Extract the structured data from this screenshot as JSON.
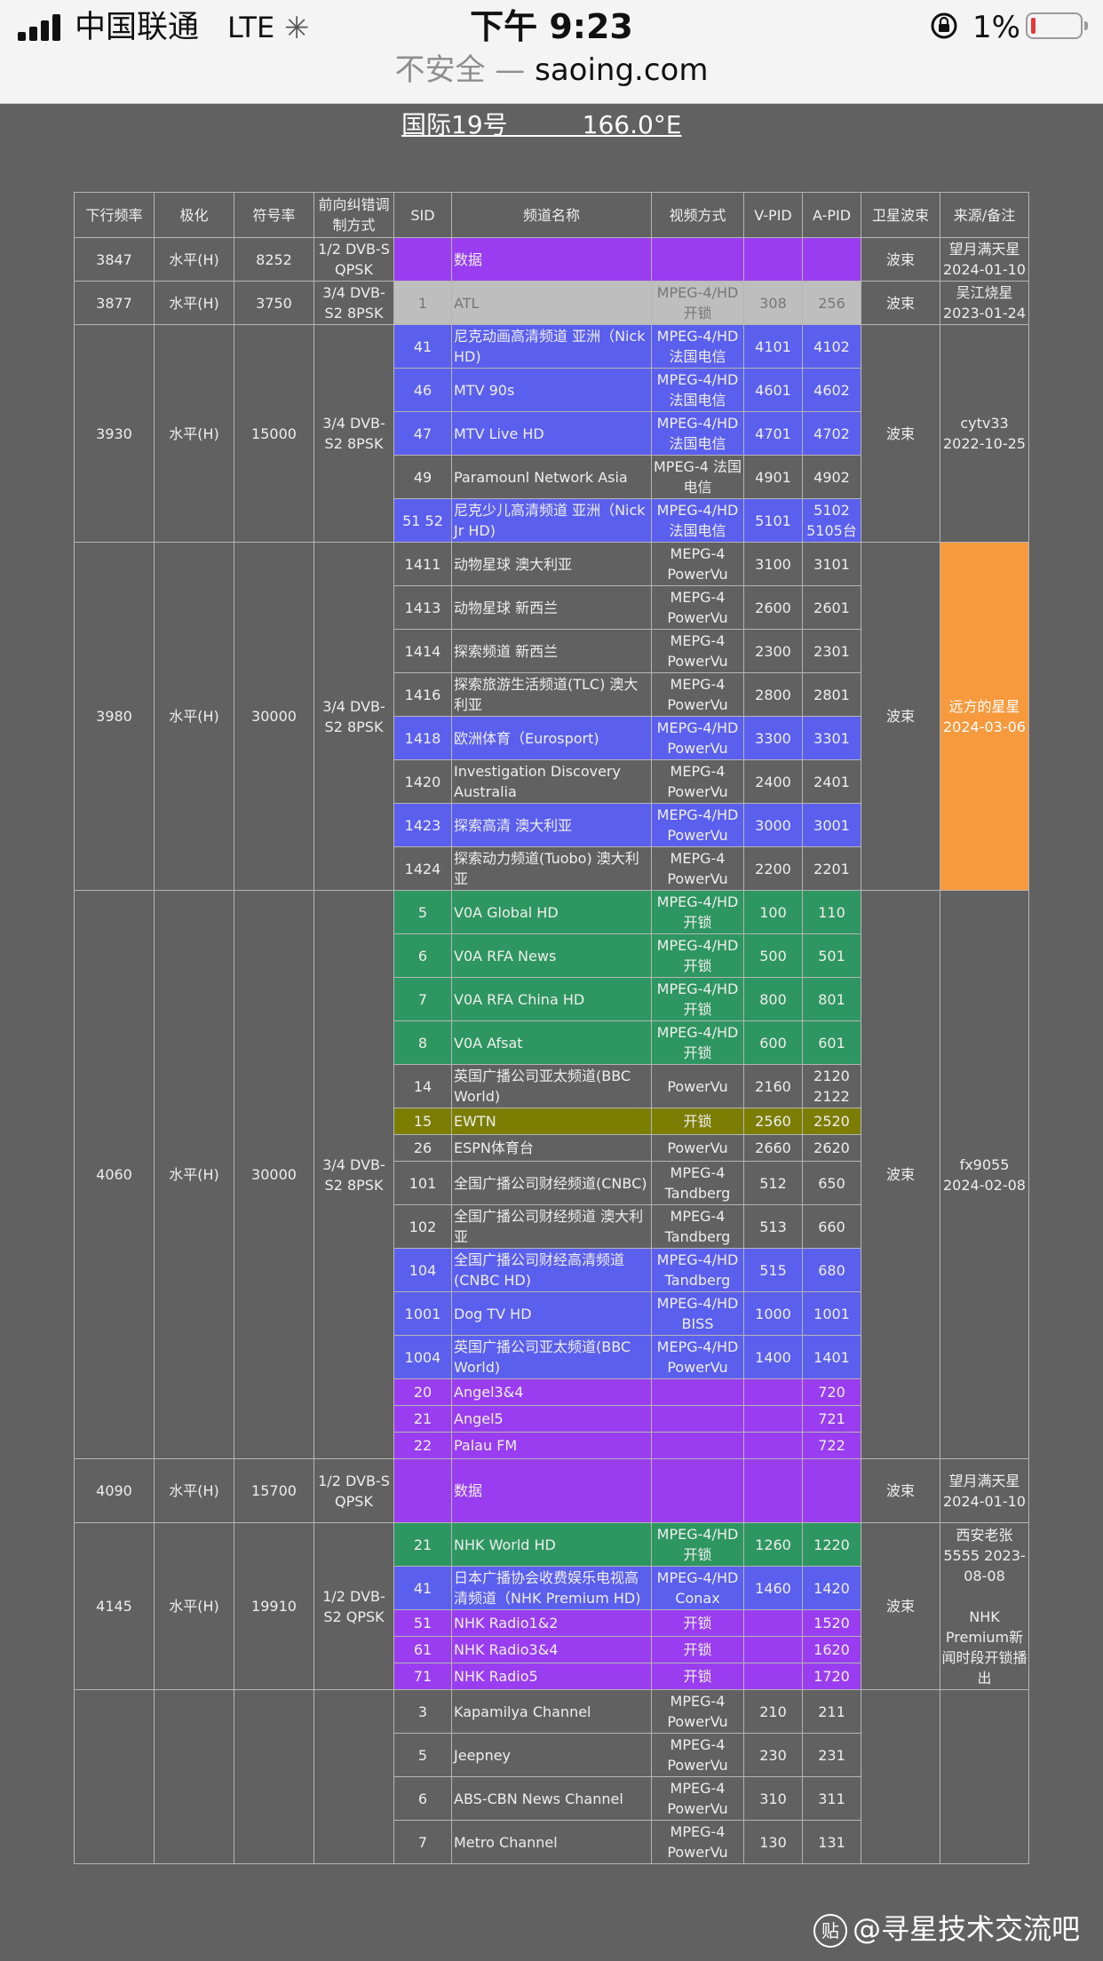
{
  "status_bar": {
    "carrier": "中国联通",
    "network": "LTE",
    "time": "下午 9:23",
    "battery_percent": "1%",
    "battery_level": 0.01
  },
  "address_bar": {
    "insecure_label": "不安全 —",
    "domain": "saoing.com"
  },
  "page": {
    "title": "国际19号　　　166.0°E"
  },
  "table": {
    "headers": [
      "下行频率",
      "极化",
      "符号率",
      "前向纠错调制方式",
      "SID",
      "频道名称",
      "视频方式",
      "V-PID",
      "A-PID",
      "卫星波束",
      "来源/备注"
    ],
    "transponders": [
      {
        "freq": "3847",
        "pol": "水平(H)",
        "sr": "8252",
        "fec": "1/2 DVB-S QPSK",
        "beam": "波束",
        "note": "望月满天星 2024-01-10",
        "channels": [
          {
            "sid": "",
            "name": "数据",
            "video": "",
            "vpid": "",
            "apid": "",
            "color": "purple"
          }
        ]
      },
      {
        "freq": "3877",
        "pol": "水平(H)",
        "sr": "3750",
        "fec": "3/4 DVB-S2 8PSK",
        "beam": "波束",
        "note": "吴江烧星 2023-01-24",
        "channels": [
          {
            "sid": "1",
            "name": "ATL",
            "video": "MPEG-4/HD 开锁",
            "vpid": "308",
            "apid": "256",
            "color": "gray"
          }
        ]
      },
      {
        "freq": "3930",
        "pol": "水平(H)",
        "sr": "15000",
        "fec": "3/4 DVB-S2 8PSK",
        "beam": "波束",
        "note": "cytv33 2022-10-25",
        "channels": [
          {
            "sid": "41",
            "name": "尼克动画高清频道 亚洲（Nick HD)",
            "video": "MPEG-4/HD 法国电信",
            "vpid": "4101",
            "apid": "4102",
            "color": "blue"
          },
          {
            "sid": "46",
            "name": "MTV 90s",
            "video": "MPEG-4/HD 法国电信",
            "vpid": "4601",
            "apid": "4602",
            "color": "blue"
          },
          {
            "sid": "47",
            "name": "MTV Live HD",
            "video": "MPEG-4/HD 法国电信",
            "vpid": "4701",
            "apid": "4702",
            "color": "blue"
          },
          {
            "sid": "49",
            "name": "Paramounl Network Asia",
            "video": "MPEG-4 法国电信",
            "vpid": "4901",
            "apid": "4902",
            "color": ""
          },
          {
            "sid": "51 52",
            "name": "尼克少儿高清频道 亚洲（Nick Jr HD)",
            "video": "MPEG-4/HD 法国电信",
            "vpid": "5101",
            "apid": "5102 5105台",
            "color": "blue"
          }
        ]
      },
      {
        "freq": "3980",
        "pol": "水平(H)",
        "sr": "30000",
        "fec": "3/4 DVB-S2 8PSK",
        "beam": "波束",
        "note": "远方的星星 2024-03-06",
        "note_color": "orange",
        "channels": [
          {
            "sid": "1411",
            "name": "动物星球 澳大利亚",
            "video": "MEPG-4 PowerVu",
            "vpid": "3100",
            "apid": "3101",
            "color": ""
          },
          {
            "sid": "1413",
            "name": "动物星球 新西兰",
            "video": "MEPG-4 PowerVu",
            "vpid": "2600",
            "apid": "2601",
            "color": ""
          },
          {
            "sid": "1414",
            "name": "探索频道 新西兰",
            "video": "MEPG-4 PowerVu",
            "vpid": "2300",
            "apid": "2301",
            "color": ""
          },
          {
            "sid": "1416",
            "name": "探索旅游生活频道(TLC) 澳大利亚",
            "video": "MEPG-4 PowerVu",
            "vpid": "2800",
            "apid": "2801",
            "color": ""
          },
          {
            "sid": "1418",
            "name": "欧洲体育（Eurosport)",
            "video": "MEPG-4/HD PowerVu",
            "vpid": "3300",
            "apid": "3301",
            "color": "blue"
          },
          {
            "sid": "1420",
            "name": "Investigation Discovery Australia",
            "video": "MEPG-4 PowerVu",
            "vpid": "2400",
            "apid": "2401",
            "color": ""
          },
          {
            "sid": "1423",
            "name": "探索高清 澳大利亚",
            "video": "MEPG-4/HD PowerVu",
            "vpid": "3000",
            "apid": "3001",
            "color": "blue"
          },
          {
            "sid": "1424",
            "name": "探索动力频道(Tuobo) 澳大利亚",
            "video": "MEPG-4 PowerVu",
            "vpid": "2200",
            "apid": "2201",
            "color": ""
          }
        ]
      },
      {
        "freq": "4060",
        "pol": "水平(H)",
        "sr": "30000",
        "fec": "3/4 DVB-S2 8PSK",
        "beam": "波束",
        "note": "fx9055 2024-02-08",
        "channels": [
          {
            "sid": "5",
            "name": "V0A Global HD",
            "video": "MPEG-4/HD 开锁",
            "vpid": "100",
            "apid": "110",
            "color": "green"
          },
          {
            "sid": "6",
            "name": "V0A RFA News",
            "video": "MPEG-4/HD 开锁",
            "vpid": "500",
            "apid": "501",
            "color": "green"
          },
          {
            "sid": "7",
            "name": "V0A RFA China HD",
            "video": "MPEG-4/HD 开锁",
            "vpid": "800",
            "apid": "801",
            "color": "green"
          },
          {
            "sid": "8",
            "name": "V0A Afsat",
            "video": "MPEG-4/HD 开锁",
            "vpid": "600",
            "apid": "601",
            "color": "green"
          },
          {
            "sid": "14",
            "name": "英国广播公司亚太频道(BBC World)",
            "video": "PowerVu",
            "vpid": "2160",
            "apid": "2120 2122",
            "color": ""
          },
          {
            "sid": "15",
            "name": "EWTN",
            "video": "开锁",
            "vpid": "2560",
            "apid": "2520",
            "color": "olive",
            "size": "sm"
          },
          {
            "sid": "26",
            "name": "ESPN体育台",
            "video": "PowerVu",
            "vpid": "2660",
            "apid": "2620",
            "color": "",
            "size": "sm"
          },
          {
            "sid": "101",
            "name": "全国广播公司财经频道(CNBC)",
            "video": "MPEG-4 Tandberg",
            "vpid": "512",
            "apid": "650",
            "color": ""
          },
          {
            "sid": "102",
            "name": "全国广播公司财经频道 澳大利亚",
            "video": "MPEG-4 Tandberg",
            "vpid": "513",
            "apid": "660",
            "color": ""
          },
          {
            "sid": "104",
            "name": "全国广播公司财经高清频道(CNBC HD)",
            "video": "MPEG-4/HD Tandberg",
            "vpid": "515",
            "apid": "680",
            "color": "blue"
          },
          {
            "sid": "1001",
            "name": "Dog TV HD",
            "video": "MPEG-4/HD BISS",
            "vpid": "1000",
            "apid": "1001",
            "color": "blue"
          },
          {
            "sid": "1004",
            "name": "英国广播公司亚太频道(BBC World)",
            "video": "MEPG-4/HD PowerVu",
            "vpid": "1400",
            "apid": "1401",
            "color": "blue"
          },
          {
            "sid": "20",
            "name": "Angel3&4",
            "video": "",
            "vpid": "",
            "apid": "720",
            "color": "purple",
            "size": "sm"
          },
          {
            "sid": "21",
            "name": "Angel5",
            "video": "",
            "vpid": "",
            "apid": "721",
            "color": "purple",
            "size": "sm"
          },
          {
            "sid": "22",
            "name": "Palau FM",
            "video": "",
            "vpid": "",
            "apid": "722",
            "color": "purple",
            "size": "sm"
          }
        ]
      },
      {
        "freq": "4090",
        "pol": "水平(H)",
        "sr": "15700",
        "fec": "1/2 DVB-S QPSK",
        "beam": "波束",
        "note": "望月满天星 2024-01-10",
        "channels": [
          {
            "sid": "",
            "name": "数据",
            "video": "",
            "vpid": "",
            "apid": "",
            "color": "purple",
            "size": "tx"
          }
        ]
      },
      {
        "freq": "4145",
        "pol": "水平(H)",
        "sr": "19910",
        "fec": "1/2 DVB-S2 QPSK",
        "beam": "波束",
        "note": "西安老张 5555 2023-08-08\n\nNHK Premium新闻时段开锁播出",
        "channels": [
          {
            "sid": "21",
            "name": "NHK World HD",
            "video": "MPEG-4/HD 开锁",
            "vpid": "1260",
            "apid": "1220",
            "color": "green"
          },
          {
            "sid": "41",
            "name": "日本广播协会收费娱乐电视高清频道（NHK Premium HD)",
            "video": "MPEG-4/HD Conax",
            "vpid": "1460",
            "apid": "1420",
            "color": "blue"
          },
          {
            "sid": "51",
            "name": "NHK Radio1&2",
            "video": "开锁",
            "vpid": "",
            "apid": "1520",
            "color": "purple",
            "size": "sm"
          },
          {
            "sid": "61",
            "name": "NHK Radio3&4",
            "video": "开锁",
            "vpid": "",
            "apid": "1620",
            "color": "purple",
            "size": "sm"
          },
          {
            "sid": "71",
            "name": "NHK Radio5",
            "video": "开锁",
            "vpid": "",
            "apid": "1720",
            "color": "purple",
            "size": "sm"
          }
        ]
      },
      {
        "freq": "",
        "pol": "",
        "sr": "",
        "fec": "",
        "beam": "",
        "note": "",
        "channels": [
          {
            "sid": "3",
            "name": "Kapamilya Channel",
            "video": "MPEG-4 PowerVu",
            "vpid": "210",
            "apid": "211",
            "color": ""
          },
          {
            "sid": "5",
            "name": "Jeepney",
            "video": "MPEG-4 PowerVu",
            "vpid": "230",
            "apid": "231",
            "color": ""
          },
          {
            "sid": "6",
            "name": "ABS-CBN News Channel",
            "video": "MPEG-4 PowerVu",
            "vpid": "310",
            "apid": "311",
            "color": ""
          },
          {
            "sid": "7",
            "name": "Metro Channel",
            "video": "MPEG-4 PowerVu",
            "vpid": "130",
            "apid": "131",
            "color": ""
          }
        ]
      }
    ]
  },
  "watermark": {
    "logo_char": "贴",
    "text": "@寻星技术交流吧"
  }
}
